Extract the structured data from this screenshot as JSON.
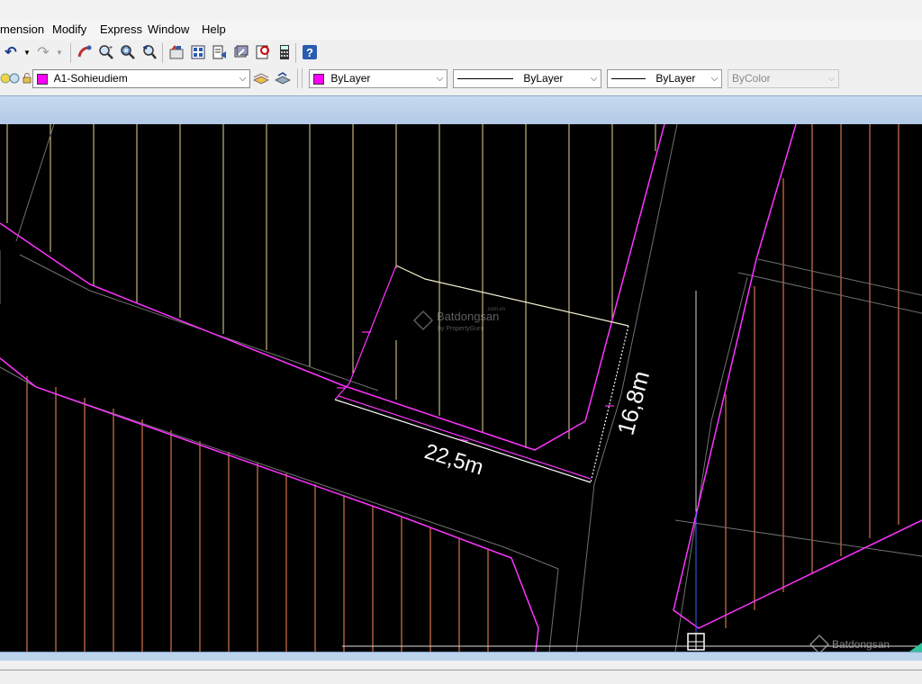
{
  "menu": {
    "items": [
      "mension",
      "Modify",
      "Express",
      "Window",
      "Help"
    ]
  },
  "toolbar": {
    "icons": [
      "undo-icon",
      "dropdown-arrow-icon",
      "redo-icon",
      "dropdown-arrow-icon",
      "pan-icon",
      "zoom-realtime-icon",
      "zoom-window-icon",
      "zoom-previous-icon",
      "properties-icon",
      "design-center-icon",
      "tool-palettes-icon",
      "sheet-set-icon",
      "markup-icon",
      "quickcalc-icon",
      "help-icon"
    ]
  },
  "layers": {
    "current_layer": "A1-Sohieudiem",
    "color": "ByLayer",
    "linetype": "ByLayer",
    "lineweight": "ByLayer",
    "plotstyle": "ByColor",
    "swatch_color": "#ff00ff"
  },
  "drawing": {
    "dim_width": "22,5m",
    "dim_depth": "16,8m",
    "watermark": "Batdongsan",
    "watermark_sub": "by PropertyGuru",
    "watermark_domain": ".com.vn"
  },
  "colors": {
    "parcel_boundary": "#ff33ff",
    "hatch_yellow": "#e8d890",
    "hatch_orange": "#ff8c5a",
    "road_edge": "#707070"
  }
}
